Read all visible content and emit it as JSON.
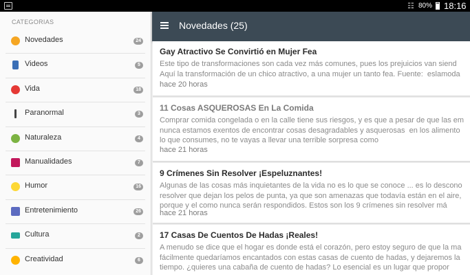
{
  "status_bar": {
    "notification_icon": "notification-icon",
    "wifi_icon": "wifi-icon",
    "battery_percent": "80%",
    "battery_icon": "battery-icon",
    "time": "18:16"
  },
  "sidebar": {
    "header": "CATEGORIAS",
    "items": [
      {
        "label": "Novedades",
        "count": "24",
        "icon": "sun-icon",
        "color": "#f5a623"
      },
      {
        "label": "Videos",
        "count": "5",
        "icon": "film-icon",
        "color": "#3b6fb6"
      },
      {
        "label": "Vida",
        "count": "18",
        "icon": "heart-icon",
        "color": "#e53935"
      },
      {
        "label": "Paranormal",
        "count": "3",
        "icon": "ghost-icon",
        "color": "#444444"
      },
      {
        "label": "Naturaleza",
        "count": "4",
        "icon": "leaf-icon",
        "color": "#7cb342"
      },
      {
        "label": "Manualidades",
        "count": "7",
        "icon": "books-icon",
        "color": "#c2185b"
      },
      {
        "label": "Humor",
        "count": "16",
        "icon": "smiley-icon",
        "color": "#fdd835"
      },
      {
        "label": "Entretenimiento",
        "count": "26",
        "icon": "confetti-icon",
        "color": "#5c6bc0"
      },
      {
        "label": "Cultura",
        "count": "2",
        "icon": "book-icon",
        "color": "#26a69a"
      },
      {
        "label": "Creatividad",
        "count": "6",
        "icon": "bulb-icon",
        "color": "#ffb300"
      }
    ]
  },
  "app_bar": {
    "menu_icon": "hamburger-icon",
    "title": "Novedades (25)"
  },
  "feed": {
    "cards": [
      {
        "title": "Gay Atractivo Se Convirtió en Mujer Fea",
        "excerpt": [
          "Este tipo de transformaciones son cada vez más comunes, pues los prejuicios van siend",
          "Aquí la transformación de un chico atractivo, a una mujer un tanto fea. Fuente:  eslamoda"
        ],
        "time": "hace 20 horas"
      },
      {
        "title": "11 Cosas ASQUEROSAS En La Comida",
        "excerpt": [
          "Comprar comida congelada o en la calle tiene sus riesgos, y es que a pesar de que las em",
          "nunca estamos exentos de encontrar cosas desagradables y asquerosas  en los alimento",
          "lo que consumes, no te vayas a llevar una terrible sorpresa como"
        ],
        "time": "hace 21 horas"
      },
      {
        "title": "9 Crímenes Sin Resolver ¡Espeluznantes!",
        "excerpt": [
          "Algunas de las cosas más inquietantes de la vida no es lo que se conoce ... es lo descono",
          "resolver que dejan los pelos de punta, ya que son amenazas que todavía están en el aire,",
          "porque y el como nunca serán respondidos. Estos son los 9 crímenes sin resolver má"
        ],
        "time": "hace 21 horas"
      },
      {
        "title": "17 Casas De Cuentos De Hadas ¡Reales!",
        "excerpt": [
          "A menudo se dice que el hogar es donde está el corazón, pero estoy seguro de que la ma",
          "fácilmente quedaríamos encantados con estas casas de cuento de hadas, y dejaremos la",
          "tiempo. ¿quieres una cabaña de cuento de hadas? Lo esencial es un lugar que propor"
        ],
        "time": ""
      }
    ]
  }
}
